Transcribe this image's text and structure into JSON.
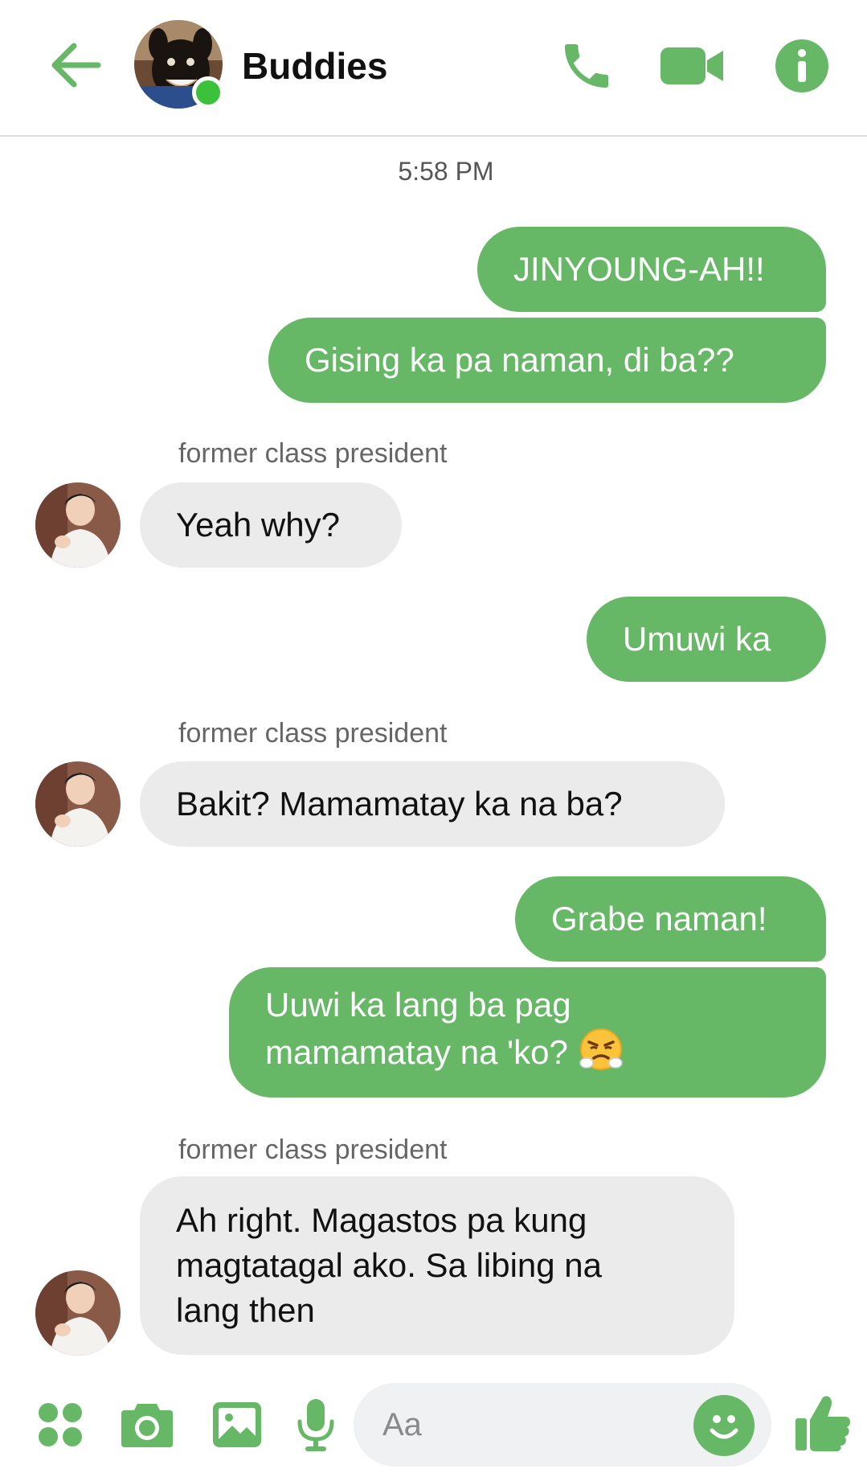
{
  "header": {
    "title": "Buddies",
    "accent_color": "#66b866",
    "online_color": "#3cc13b",
    "icons": [
      "arrow-left-icon",
      "phone-icon",
      "video-camera-icon",
      "info-icon"
    ]
  },
  "conversation": {
    "timestamp": "5:58 PM",
    "sender_name": "former class president",
    "messages": [
      {
        "direction": "outgoing",
        "text": "JINYOUNG-AH!!"
      },
      {
        "direction": "outgoing",
        "text": "Gising ka pa naman, di ba??"
      },
      {
        "direction": "incoming",
        "sender": "former class president",
        "text": "Yeah why?"
      },
      {
        "direction": "outgoing",
        "text": "Umuwi ka"
      },
      {
        "direction": "incoming",
        "sender": "former class president",
        "text": "Bakit? Mamamatay ka na ba?"
      },
      {
        "direction": "outgoing",
        "text": "Grabe naman!"
      },
      {
        "direction": "outgoing",
        "text": "Uuwi ka lang ba pag mamamatay na 'ko?",
        "emoji": "huffing-face-emoji"
      },
      {
        "direction": "incoming",
        "sender": "former class president",
        "text": "Ah right. Magastos pa kung magtatagal ako. Sa libing na lang then"
      }
    ]
  },
  "composer": {
    "placeholder": "Aa",
    "value": "",
    "icons": [
      "apps-icon",
      "camera-icon",
      "image-icon",
      "microphone-icon",
      "smiley-icon",
      "thumbs-up-icon"
    ]
  }
}
